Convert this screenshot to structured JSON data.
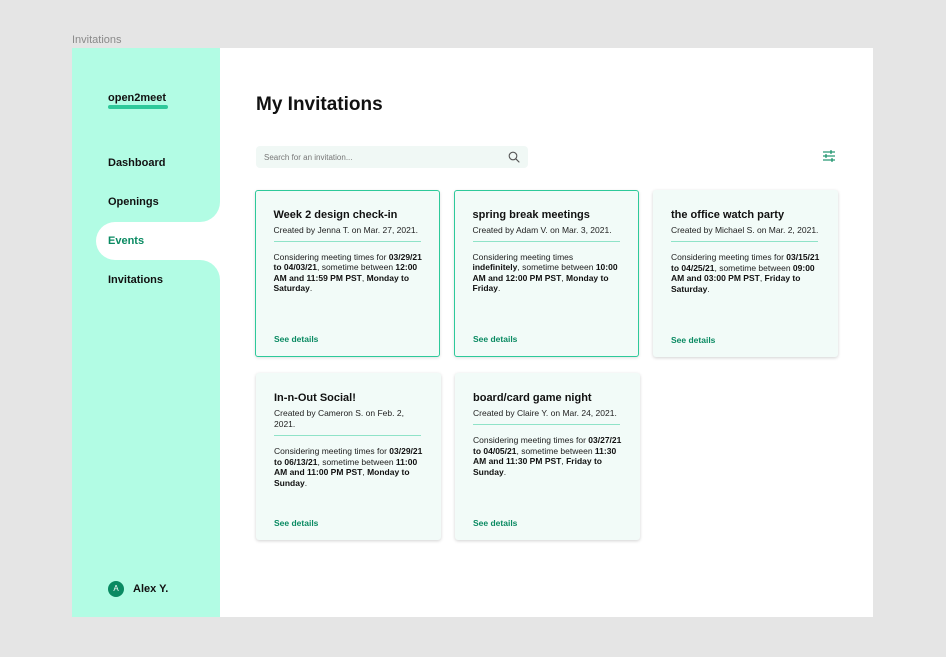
{
  "frame_label": "Invitations",
  "sidebar": {
    "logo": "open2meet",
    "nav": [
      {
        "label": "Dashboard"
      },
      {
        "label": "Openings"
      },
      {
        "label": "Events"
      },
      {
        "label": "Invitations"
      }
    ],
    "active_index": 2,
    "user": {
      "initial": "A",
      "name": "Alex Y."
    }
  },
  "main": {
    "title": "My Invitations",
    "search": {
      "placeholder": "Search for an invitation..."
    },
    "see_details_label": "See details",
    "cards": [
      {
        "title": "Week 2 design check-in",
        "meta": "Created by Jenna T. on Mar. 27, 2021.",
        "body_prefix": "Considering meeting times for ",
        "range": "03/29/21 to 04/03/21",
        "mid": ", sometime between ",
        "times": "12:00 AM and 11:59 PM",
        "tz": "PST",
        "sep": ", ",
        "days": "Monday to Saturday",
        "end": ".",
        "selected": true
      },
      {
        "title": "spring break meetings",
        "meta": "Created by Adam V. on Mar. 3, 2021.",
        "body_prefix": "Considering meeting times ",
        "range": "indefinitely",
        "mid": ", sometime between ",
        "times": "10:00 AM and 12:00 PM PST",
        "tz": "",
        "sep": ", ",
        "days": "Monday to Friday",
        "end": ".",
        "selected": true
      },
      {
        "title": "the office watch party",
        "meta": "Created by Michael S. on Mar. 2, 2021.",
        "body_prefix": "Considering meeting times for ",
        "range": "03/15/21 to 04/25/21",
        "mid": ", sometime between ",
        "times": "09:00 AM and 03:00 PM",
        "tz": "PST",
        "sep": ", ",
        "days": "Friday to Saturday",
        "end": ".",
        "selected": false
      },
      {
        "title": "In-n-Out Social!",
        "meta": "Created by Cameron S. on Feb. 2, 2021.",
        "body_prefix": "Considering meeting times for ",
        "range": "03/29/21 to 06/13/21",
        "mid": ", sometime between ",
        "times": "11:00 AM and 11:00 PM",
        "tz": "PST",
        "sep": ", ",
        "days": "Monday to Sunday",
        "end": ".",
        "selected": false
      },
      {
        "title": "board/card game night",
        "meta": "Created by Claire Y. on Mar. 24, 2021.",
        "body_prefix": "Considering meeting times for ",
        "range": "03/27/21 to 04/05/21",
        "mid": ", sometime between ",
        "times": "11:30 AM and 11:30 PM",
        "tz": "PST",
        "sep": ", ",
        "days": "Friday to Sunday",
        "end": ".",
        "selected": false
      }
    ]
  },
  "icons": {
    "search": "search-icon",
    "filter": "sliders-icon"
  },
  "colors": {
    "sidebar_bg": "#b2fce4",
    "accent": "#0a8a62",
    "accent_light": "#2ec99a",
    "card_bg": "#f2fbf8"
  }
}
